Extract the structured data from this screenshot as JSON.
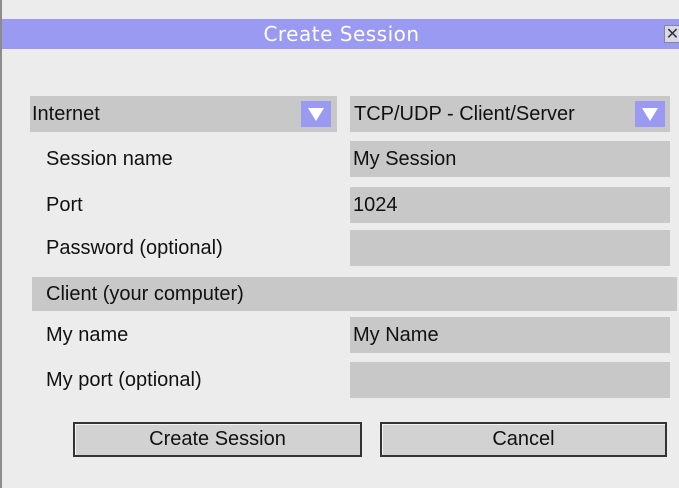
{
  "window": {
    "title": "Create Session",
    "close_glyph": "✕"
  },
  "network_dropdown": {
    "value": "Internet",
    "icon": "chevron-down-icon"
  },
  "protocol_dropdown": {
    "value": "TCP/UDP - Client/Server",
    "icon": "chevron-down-icon"
  },
  "fields": {
    "session_name": {
      "label": "Session name",
      "value": "My Session"
    },
    "port": {
      "label": "Port",
      "value": "1024"
    },
    "password": {
      "label": "Password (optional)",
      "value": ""
    }
  },
  "client_section": {
    "title": "Client (your computer)"
  },
  "client_fields": {
    "my_name": {
      "label": "My name",
      "value": "My Name"
    },
    "my_port": {
      "label": "My port (optional)",
      "value": ""
    }
  },
  "buttons": {
    "create": "Create Session",
    "cancel": "Cancel"
  },
  "colors": {
    "accent": "#9b9af2",
    "field": "#c8c8c8",
    "background": "#ececec"
  }
}
